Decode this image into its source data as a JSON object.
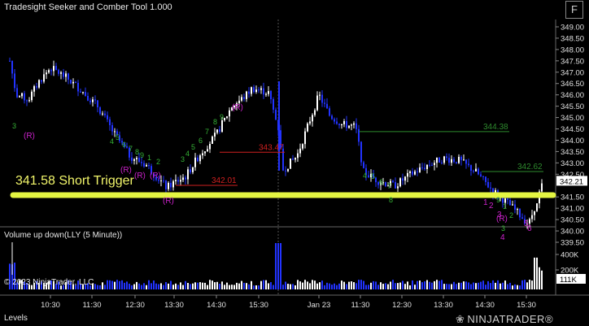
{
  "window": {
    "title": "Tradesight Seeker and Comber Tool 1.000",
    "fullscreen_label": "F"
  },
  "price_panel": {
    "axis_ticks": [
      "349.00",
      "348.50",
      "348.00",
      "347.50",
      "347.00",
      "346.50",
      "346.00",
      "345.50",
      "345.00",
      "344.50",
      "344.00",
      "343.50",
      "343.00",
      "342.50",
      "341.50",
      "341.00",
      "340.50",
      "340.00",
      "339.50"
    ],
    "price_badge": "342.21",
    "trigger_label": "341.58 Short Trigger",
    "levels": [
      {
        "label": "344.38",
        "price": 344.38
      },
      {
        "label": "343.47",
        "price": 343.47
      },
      {
        "label": "342.62",
        "price": 342.62
      },
      {
        "label": "342.01",
        "price": 342.01
      }
    ]
  },
  "volume_panel": {
    "title": "Volume up down(LLY (5 Minute))",
    "axis_ticks": [
      "400K",
      "200K"
    ],
    "value_badge": "111K"
  },
  "time_axis": [
    "10:30",
    "11:30",
    "12:30",
    "13:30",
    "14:30",
    "15:30",
    "Jan 23",
    "11:30",
    "12:30",
    "13:30",
    "14:30",
    "15:30"
  ],
  "footer": {
    "copyright": "© 2023 NinjaTrader, LLC",
    "levels_label": "Levels",
    "brand": "NINJATRADER",
    "brand_mark": "®"
  },
  "markers": {
    "setup_counts_green": [
      "3",
      "4",
      "5",
      "6",
      "7",
      "8",
      "9",
      "1",
      "2",
      "3",
      "4",
      "5",
      "6",
      "7",
      "8",
      "9"
    ],
    "countdown_magenta": [
      "1",
      "2",
      "3",
      "4",
      "5",
      "6"
    ],
    "recycle": "(R)"
  },
  "colors": {
    "background": "#000000",
    "up_bar": "#ffffff",
    "down_bar": "#2233ff",
    "trigger_line": "#e4f542",
    "level_green": "#2e8b2e",
    "level_red": "#d02020",
    "setup_green": "#35b035",
    "countdown_magenta": "#cc22cc"
  }
}
